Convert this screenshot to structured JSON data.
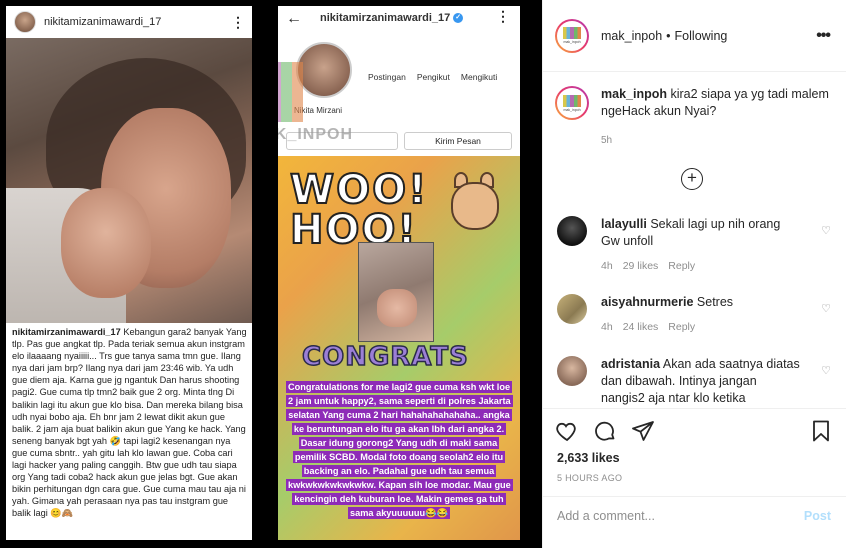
{
  "left_story": {
    "username": "nikitamizanimawardi_17",
    "caption_user": "nikitamirzanimawardi_17",
    "caption_text": "Kebangun gara2 banyak Yang tlp. Pas gue angkat tlp. Pada teriak semua akun instgram elo ilaaaang nyaiiiii... Trs gue tanya sama tmn gue. Ilang nya dari jam brp? Ilang nya dari jam 23:46 wib. Ya udh gue diem aja. Karna gue jg ngantuk Dan harus shooting pagi2. Gue cuma tlp tmn2 baik gue 2 org. Minta tlng Di balikin lagi itu akun gue klo bisa. Dan mereka bilang bisa udh nyai bobo aja. Eh bnr jam 2 lewat dikit akun gue balik. 2 jam aja buat balikin akun gue Yang ke hack. Yang seneng banyak bgt yah 🤣 tapi lagi2 kesenangan nya gue cuma sbntr.. yah gitu lah klo lawan gue. Coba cari lagi hacker yang paling canggih. Btw gue udh tau siapa org Yang tadi coba2 hack akun gue jelas bgt. Gue akan bikin perhitungan dgn cara gue. Gue cuma mau tau aja ni yah. Gimana yah perasaan nya pas tau instgram gue balik lagi 😊🙈"
  },
  "right_story": {
    "username": "nikitamirzanimawardi_17",
    "verified_mark": "✓",
    "display_name": "Nikita Mirzani",
    "stats": [
      "Postingan",
      "Pengikut",
      "Mengikuti"
    ],
    "message_button": "Kirim Pesan",
    "watermark": "MAK_INPOH",
    "sticker_text": "WOO! HOO!",
    "congrats": "CONGRATS",
    "caption": "Congratulations for me lagi2 gue cuma ksh wkt loe 2 jam untuk happy2, sama seperti di polres Jakarta selatan Yang cuma 2 hari hahahahahahaha.. angka ke beruntungan elo itu ga akan lbh dari angka 2. Dasar idung gorong2 Yang udh di maki sama pemilik SCBD. Modal foto doang seolah2 elo itu backing an elo. Padahal gue udh tau semua kwkwkwkwkwkwkw. Kapan sih loe modar. Mau gue kencingin deh kuburan loe. Makin gemes ga tuh sama akyuuuuuu😂😂"
  },
  "post": {
    "account": "mak_inpoh",
    "follow_label": "Following",
    "logo_text": "mak_inpoh",
    "caption": "kira2 siapa ya yg tadi malem ngeHack akun Nyai?",
    "caption_age": "5h",
    "likes": "2,633 likes",
    "posted": "5 HOURS AGO",
    "comment_placeholder": "Add a comment...",
    "post_button": "Post"
  },
  "comments": [
    {
      "user": "lalayulli",
      "text": "Sekali lagi up nih orang Gw unfoll",
      "age": "4h",
      "likes": "29 likes",
      "reply": "Reply"
    },
    {
      "user": "aisyahnurmerie",
      "text": "Setres",
      "age": "4h",
      "likes": "24 likes",
      "reply": "Reply"
    },
    {
      "user": "adristania",
      "text": "Akan ada saatnya diatas dan dibawah. Intinya jangan nangis2 aja ntar klo ketika",
      "age": "",
      "likes": "",
      "reply": ""
    }
  ],
  "icons": {
    "dots": "⋮",
    "more": "•••",
    "back": "←",
    "plus": "+",
    "heart": "♡"
  }
}
